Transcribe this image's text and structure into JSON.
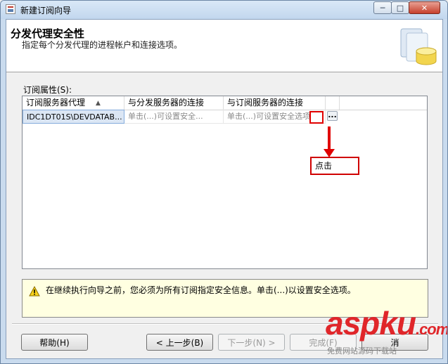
{
  "window": {
    "title": "新建订阅向导",
    "controls": {
      "minimize": "─",
      "maximize": "□",
      "close": "✕"
    }
  },
  "header": {
    "title": "分发代理安全性",
    "subtitle": "指定每个分发代理的进程帐户和连接选项。",
    "art_icon": "database-wizard-art"
  },
  "grid": {
    "label": "订阅属性(S):",
    "columns": [
      "订阅服务器代理",
      "与分发服务器的连接",
      "与订阅服务器的连接"
    ],
    "sort_indicator": "▲",
    "rows": [
      {
        "agent": "IDC1DT01S\\DEVDATAB...",
        "distributor_conn": "单击(...)可设置安全...",
        "subscriber_conn": "单击(...)可设置安全选项",
        "button": "..."
      }
    ]
  },
  "annotation": {
    "callout": "点击",
    "color": "#e00000"
  },
  "warning": {
    "icon": "warning-icon",
    "text": "在继续执行向导之前，您必须为所有订阅指定安全信息。单击(...)以设置安全选项。"
  },
  "buttons": {
    "help": "帮助(H)",
    "back": "< 上一步(B)",
    "next": "下一步(N) >",
    "finish": "完成(F)",
    "cancel": "消"
  },
  "watermark": {
    "brand": "asp",
    "brand2": "ku",
    "domain": ".com",
    "sub": "免费网站源码下载站"
  }
}
